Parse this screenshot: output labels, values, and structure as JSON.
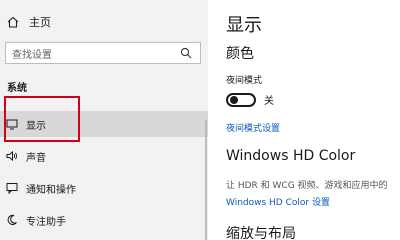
{
  "sidebar": {
    "home_label": "主页",
    "search_placeholder": "查找设置",
    "section_label": "系统",
    "items": [
      {
        "label": "显示",
        "icon": "monitor-icon"
      },
      {
        "label": "声音",
        "icon": "speaker-icon"
      },
      {
        "label": "通知和操作",
        "icon": "notification-icon"
      },
      {
        "label": "专注助手",
        "icon": "moon-icon"
      }
    ]
  },
  "main": {
    "title": "显示",
    "color_heading": "颜色",
    "night_mode_label": "夜间模式",
    "night_mode_state": "关",
    "night_mode_settings_link": "夜间模式设置",
    "hdr_heading": "Windows HD Color",
    "hdr_description": "让 HDR 和 WCG 视频、游戏和应用中的",
    "hdr_link": "Windows HD Color 设置",
    "scale_heading": "缩放与布局"
  },
  "colors": {
    "accent_link": "#0a5bbd",
    "highlight_box": "#d0021b",
    "sidebar_bg": "#f2f2f2"
  }
}
